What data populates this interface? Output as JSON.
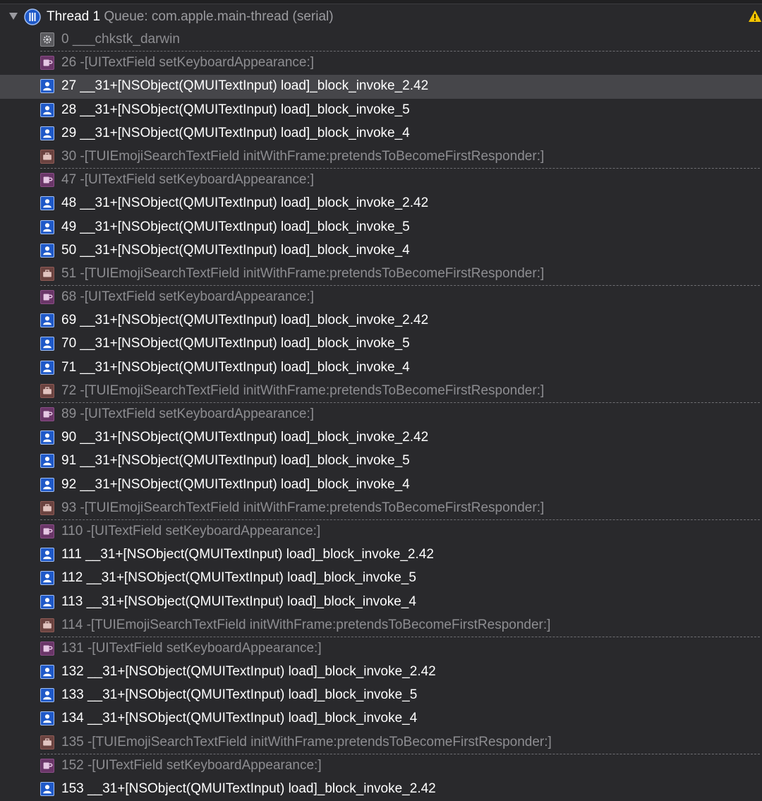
{
  "thread": {
    "title": "Thread 1",
    "queue": "Queue: com.apple.main-thread (serial)"
  },
  "frames": [
    {
      "label": "0 ___chkstk_darwin",
      "kind": "system",
      "sep": true,
      "selected": false
    },
    {
      "label": "26 -[UITextField setKeyboardAppearance:]",
      "kind": "uikit",
      "sep": false,
      "selected": false
    },
    {
      "label": "27 __31+[NSObject(QMUITextInput) load]_block_invoke_2.42",
      "kind": "user",
      "sep": false,
      "selected": true
    },
    {
      "label": "28 __31+[NSObject(QMUITextInput) load]_block_invoke_5",
      "kind": "user",
      "sep": false,
      "selected": false
    },
    {
      "label": "29 __31+[NSObject(QMUITextInput) load]_block_invoke_4",
      "kind": "user",
      "sep": false,
      "selected": false
    },
    {
      "label": "30 -[TUIEmojiSearchTextField initWithFrame:pretendsToBecomeFirstResponder:]",
      "kind": "framework",
      "sep": true,
      "selected": false
    },
    {
      "label": "47 -[UITextField setKeyboardAppearance:]",
      "kind": "uikit",
      "sep": false,
      "selected": false
    },
    {
      "label": "48 __31+[NSObject(QMUITextInput) load]_block_invoke_2.42",
      "kind": "user",
      "sep": false,
      "selected": false
    },
    {
      "label": "49 __31+[NSObject(QMUITextInput) load]_block_invoke_5",
      "kind": "user",
      "sep": false,
      "selected": false
    },
    {
      "label": "50 __31+[NSObject(QMUITextInput) load]_block_invoke_4",
      "kind": "user",
      "sep": false,
      "selected": false
    },
    {
      "label": "51 -[TUIEmojiSearchTextField initWithFrame:pretendsToBecomeFirstResponder:]",
      "kind": "framework",
      "sep": true,
      "selected": false
    },
    {
      "label": "68 -[UITextField setKeyboardAppearance:]",
      "kind": "uikit",
      "sep": false,
      "selected": false
    },
    {
      "label": "69 __31+[NSObject(QMUITextInput) load]_block_invoke_2.42",
      "kind": "user",
      "sep": false,
      "selected": false
    },
    {
      "label": "70 __31+[NSObject(QMUITextInput) load]_block_invoke_5",
      "kind": "user",
      "sep": false,
      "selected": false
    },
    {
      "label": "71 __31+[NSObject(QMUITextInput) load]_block_invoke_4",
      "kind": "user",
      "sep": false,
      "selected": false
    },
    {
      "label": "72 -[TUIEmojiSearchTextField initWithFrame:pretendsToBecomeFirstResponder:]",
      "kind": "framework",
      "sep": true,
      "selected": false
    },
    {
      "label": "89 -[UITextField setKeyboardAppearance:]",
      "kind": "uikit",
      "sep": false,
      "selected": false
    },
    {
      "label": "90 __31+[NSObject(QMUITextInput) load]_block_invoke_2.42",
      "kind": "user",
      "sep": false,
      "selected": false
    },
    {
      "label": "91 __31+[NSObject(QMUITextInput) load]_block_invoke_5",
      "kind": "user",
      "sep": false,
      "selected": false
    },
    {
      "label": "92 __31+[NSObject(QMUITextInput) load]_block_invoke_4",
      "kind": "user",
      "sep": false,
      "selected": false
    },
    {
      "label": "93 -[TUIEmojiSearchTextField initWithFrame:pretendsToBecomeFirstResponder:]",
      "kind": "framework",
      "sep": true,
      "selected": false
    },
    {
      "label": "110 -[UITextField setKeyboardAppearance:]",
      "kind": "uikit",
      "sep": false,
      "selected": false
    },
    {
      "label": "111 __31+[NSObject(QMUITextInput) load]_block_invoke_2.42",
      "kind": "user",
      "sep": false,
      "selected": false
    },
    {
      "label": "112 __31+[NSObject(QMUITextInput) load]_block_invoke_5",
      "kind": "user",
      "sep": false,
      "selected": false
    },
    {
      "label": "113 __31+[NSObject(QMUITextInput) load]_block_invoke_4",
      "kind": "user",
      "sep": false,
      "selected": false
    },
    {
      "label": "114 -[TUIEmojiSearchTextField initWithFrame:pretendsToBecomeFirstResponder:]",
      "kind": "framework",
      "sep": true,
      "selected": false
    },
    {
      "label": "131 -[UITextField setKeyboardAppearance:]",
      "kind": "uikit",
      "sep": false,
      "selected": false
    },
    {
      "label": "132 __31+[NSObject(QMUITextInput) load]_block_invoke_2.42",
      "kind": "user",
      "sep": false,
      "selected": false
    },
    {
      "label": "133 __31+[NSObject(QMUITextInput) load]_block_invoke_5",
      "kind": "user",
      "sep": false,
      "selected": false
    },
    {
      "label": "134 __31+[NSObject(QMUITextInput) load]_block_invoke_4",
      "kind": "user",
      "sep": false,
      "selected": false
    },
    {
      "label": "135 -[TUIEmojiSearchTextField initWithFrame:pretendsToBecomeFirstResponder:]",
      "kind": "framework",
      "sep": true,
      "selected": false
    },
    {
      "label": "152 -[UITextField setKeyboardAppearance:]",
      "kind": "uikit",
      "sep": false,
      "selected": false
    },
    {
      "label": "153 __31+[NSObject(QMUITextInput) load]_block_invoke_2.42",
      "kind": "user",
      "sep": false,
      "selected": false
    }
  ],
  "icons": {
    "thread": "thread-icon",
    "warning": "warning-icon",
    "disclosure": "disclosure-triangle-icon",
    "user": "user-frame-icon",
    "system": "gear-frame-icon",
    "uikit": "mug-frame-icon",
    "framework": "briefcase-frame-icon"
  },
  "colors": {
    "background": "#29292c",
    "selected_row": "#46464a",
    "user_text": "#ffffff",
    "system_text": "#8d8d91",
    "thread_icon": "#1f59c8",
    "warning": "#f5c400"
  }
}
